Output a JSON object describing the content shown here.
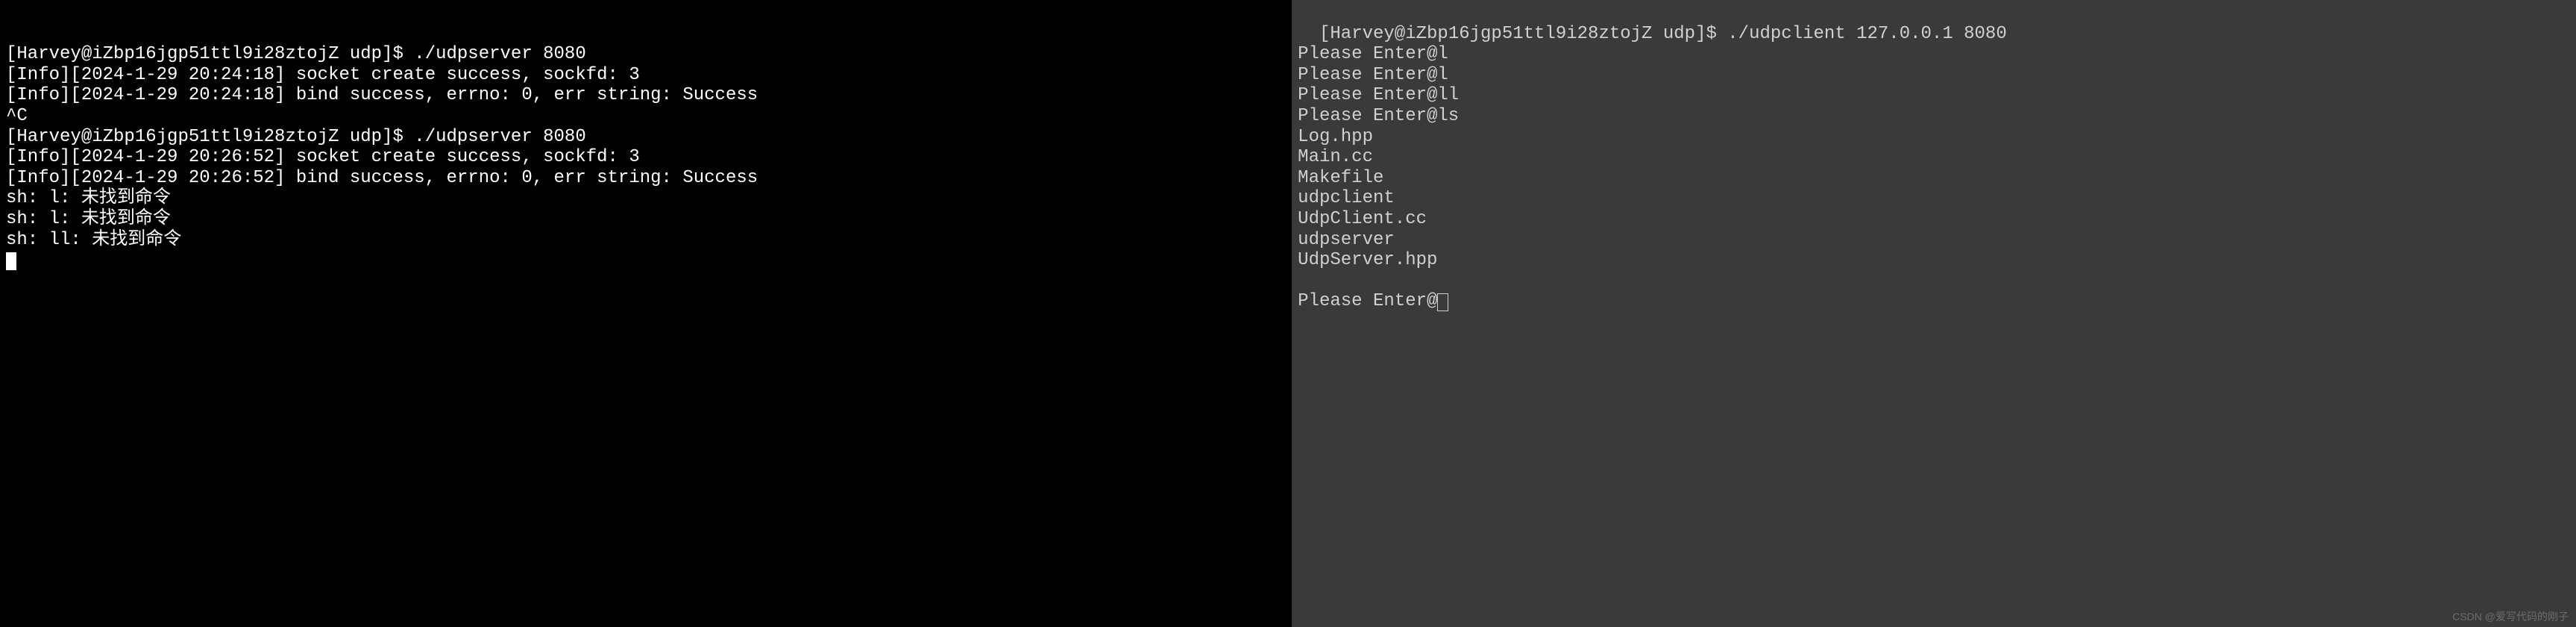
{
  "left": {
    "lines": [
      "",
      "[Harvey@iZbp16jgp51ttl9i28ztojZ udp]$ ./udpserver 8080",
      "[Info][2024-1-29 20:24:18] socket create success, sockfd: 3",
      "[Info][2024-1-29 20:24:18] bind success, errno: 0, err string: Success",
      "^C",
      "[Harvey@iZbp16jgp51ttl9i28ztojZ udp]$ ./udpserver 8080",
      "[Info][2024-1-29 20:26:52] socket create success, sockfd: 3",
      "[Info][2024-1-29 20:26:52] bind success, errno: 0, err string: Success",
      "sh: l: 未找到命令",
      "sh: l: 未找到命令",
      "sh: ll: 未找到命令"
    ],
    "cursor": "block"
  },
  "right": {
    "lines": [
      "[Harvey@iZbp16jgp51ttl9i28ztojZ udp]$ ./udpclient 127.0.0.1 8080",
      "Please Enter@l",
      "Please Enter@l",
      "Please Enter@ll",
      "Please Enter@ls",
      "Log.hpp",
      "Main.cc",
      "Makefile",
      "udpclient",
      "UdpClient.cc",
      "udpserver",
      "UdpServer.hpp",
      "",
      "Please Enter@"
    ],
    "cursor": "outline"
  },
  "watermark": "CSDN @爱写代码的刚子"
}
